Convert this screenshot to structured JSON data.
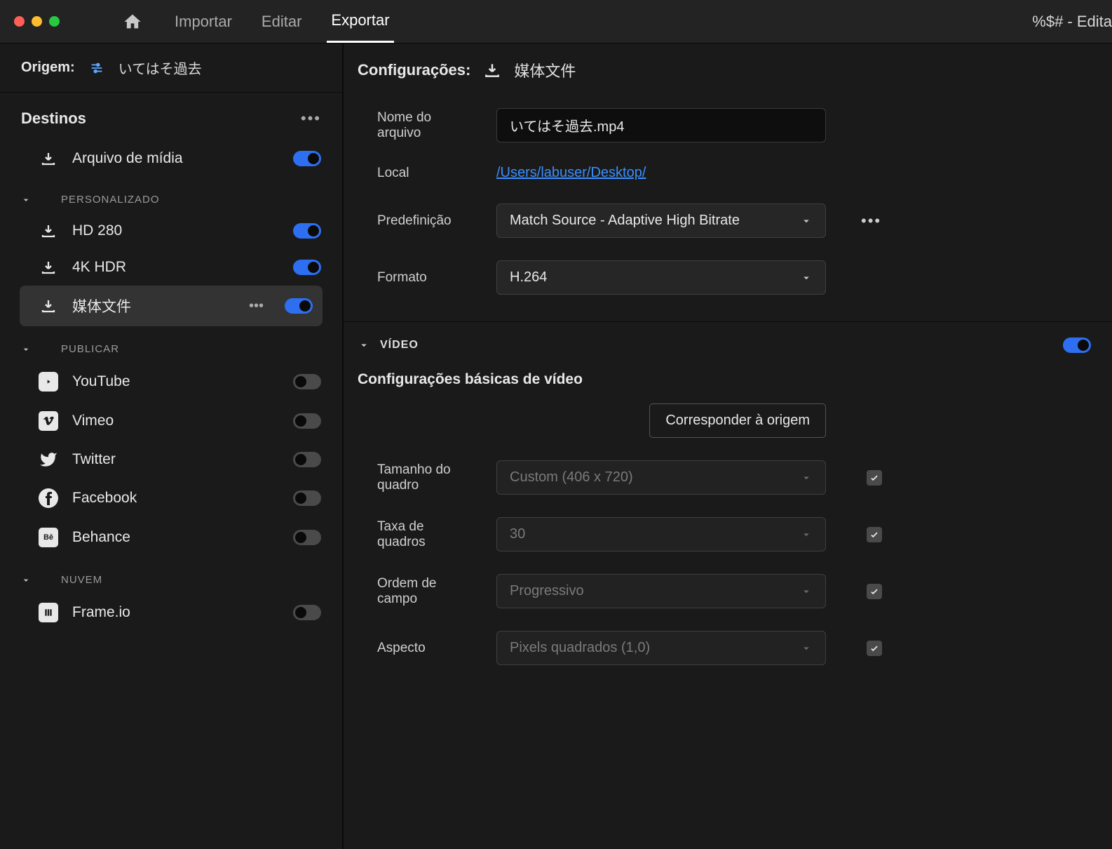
{
  "titlebar": {
    "tabs": {
      "import": "Importar",
      "edit": "Editar",
      "export": "Exportar"
    },
    "right": "%$# - Edita"
  },
  "origin": {
    "label": "Origem:",
    "name": "いてはそ過去"
  },
  "destinations": {
    "title": "Destinos",
    "media_file": "Arquivo de mídia",
    "group_custom": "PERSONALIZADO",
    "custom": [
      {
        "label": "HD 280"
      },
      {
        "label": "4K HDR"
      },
      {
        "label": "媒体文件"
      }
    ],
    "group_publish": "PUBLICAR",
    "publish": [
      {
        "label": "YouTube"
      },
      {
        "label": "Vimeo"
      },
      {
        "label": "Twitter"
      },
      {
        "label": "Facebook"
      },
      {
        "label": "Behance"
      }
    ],
    "group_cloud": "NUVEM",
    "cloud": [
      {
        "label": "Frame.io"
      }
    ]
  },
  "settings": {
    "label": "Configurações:",
    "name": "媒体文件",
    "filename_label": "Nome do arquivo",
    "filename_value": "いてはそ過去.mp4",
    "location_label": "Local",
    "location_value": "/Users/labuser/Desktop/",
    "preset_label": "Predefinição",
    "preset_value": "Match Source - Adaptive High Bitrate",
    "format_label": "Formato",
    "format_value": "H.264"
  },
  "video": {
    "section": "VÍDEO",
    "subtitle": "Configurações básicas de vídeo",
    "match_source": "Corresponder à origem",
    "frame_size_label": "Tamanho do quadro",
    "frame_size_value": "Custom (406 x 720)",
    "frame_rate_label": "Taxa de quadros",
    "frame_rate_value": "30",
    "field_order_label": "Ordem de campo",
    "field_order_value": "Progressivo",
    "aspect_label": "Aspecto",
    "aspect_value": "Pixels quadrados (1,0)"
  }
}
